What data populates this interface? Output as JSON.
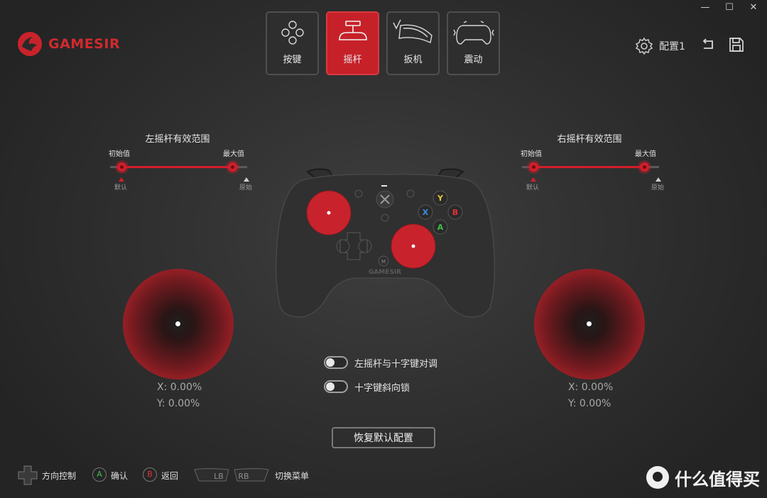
{
  "window": {
    "minimize": "—",
    "maximize": "☐",
    "close": "✕"
  },
  "brand": {
    "name": "GAMESIR"
  },
  "tabs": [
    {
      "id": "buttons",
      "label": "按键",
      "active": false
    },
    {
      "id": "sticks",
      "label": "摇杆",
      "active": true
    },
    {
      "id": "triggers",
      "label": "扳机",
      "active": false
    },
    {
      "id": "vibration",
      "label": "震动",
      "active": false
    }
  ],
  "header": {
    "profile_label": "配置1"
  },
  "left_range": {
    "title": "左摇杆有效范围",
    "min_label": "初始值",
    "max_label": "最大值",
    "default_label": "默认",
    "origin_label": "原始",
    "min_value": 0.1,
    "max_value": 0.9
  },
  "right_range": {
    "title": "右摇杆有效范围",
    "min_label": "初始值",
    "max_label": "最大值",
    "default_label": "默认",
    "origin_label": "原始",
    "min_value": 0.1,
    "max_value": 0.9
  },
  "left_stick": {
    "x_label": "X:",
    "x_value": "0.00%",
    "y_label": "Y:",
    "y_value": "0.00%"
  },
  "right_stick": {
    "x_label": "X:",
    "x_value": "0.00%",
    "y_label": "Y:",
    "y_value": "0.00%"
  },
  "controller": {
    "brand": "GAMESIR",
    "face_buttons": {
      "y": "Y",
      "x": "X",
      "b": "B",
      "a": "A"
    },
    "m_button": "M"
  },
  "options": [
    {
      "label": "左摇杆与十字键对调",
      "enabled": false
    },
    {
      "label": "十字键斜向锁",
      "enabled": false
    }
  ],
  "reset_button": "恢复默认配置",
  "footer": {
    "dpad_label": "方向控制",
    "a_badge": "A",
    "confirm_label": "确认",
    "b_badge": "B",
    "back_label": "返回",
    "lb": "LB",
    "rb": "RB",
    "switch_label": "切换菜单"
  },
  "watermark": {
    "text": "什么值得买"
  },
  "colors": {
    "accent": "#d21e2a",
    "a_green": "#3fbf4a",
    "b_red": "#e0303a",
    "x_blue": "#3a8fe0",
    "y_yellow": "#e8c53a"
  }
}
